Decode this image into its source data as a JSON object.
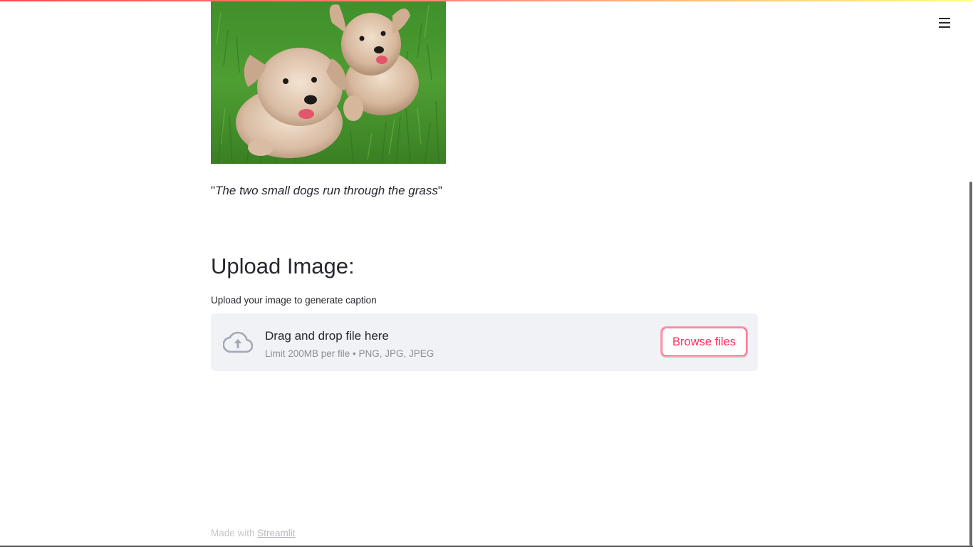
{
  "app": {
    "accent_color": "#ff4b4b",
    "menu_icon": "hamburger-icon"
  },
  "result": {
    "image_alt": "Two small dogs running through grass",
    "caption_open_quote": "\"",
    "caption_text": "The two small dogs run through the grass",
    "caption_close_quote": "\""
  },
  "upload": {
    "heading": "Upload Image:",
    "label": "Upload your image to generate caption",
    "dropzone_title": "Drag and drop file here",
    "dropzone_limit": "Limit 200MB per file • PNG, JPG, JPEG",
    "browse_label": "Browse files",
    "cloud_icon": "cloud-upload-icon"
  },
  "footer": {
    "prefix": "Made with ",
    "link_text": "Streamlit"
  }
}
